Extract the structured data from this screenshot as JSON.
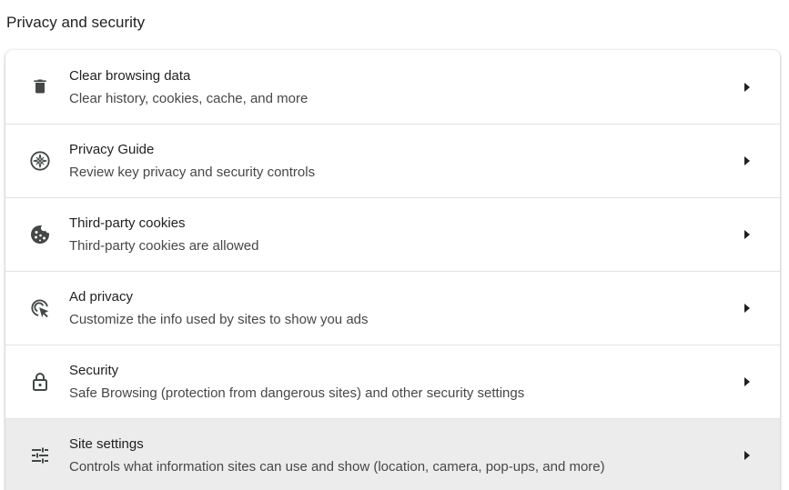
{
  "section": {
    "title": "Privacy and security"
  },
  "items": [
    {
      "icon": "trash-icon",
      "label": "Clear browsing data",
      "sublabel": "Clear history, cookies, cache, and more"
    },
    {
      "icon": "compass-icon",
      "label": "Privacy Guide",
      "sublabel": "Review key privacy and security controls"
    },
    {
      "icon": "cookie-icon",
      "label": "Third-party cookies",
      "sublabel": "Third-party cookies are allowed"
    },
    {
      "icon": "ad-privacy-icon",
      "label": "Ad privacy",
      "sublabel": "Customize the info used by sites to show you ads"
    },
    {
      "icon": "lock-icon",
      "label": "Security",
      "sublabel": "Safe Browsing (protection from dangerous sites) and other security settings"
    },
    {
      "icon": "tune-icon",
      "label": "Site settings",
      "sublabel": "Controls what information sites can use and show (location, camera, pop-ups, and more)",
      "active": true
    }
  ],
  "colors": {
    "icon": "#444746",
    "text_primary": "#1f1f1f",
    "text_secondary": "#474747",
    "active_row_bg": "#ececec",
    "divider": "#e3e3e3"
  }
}
